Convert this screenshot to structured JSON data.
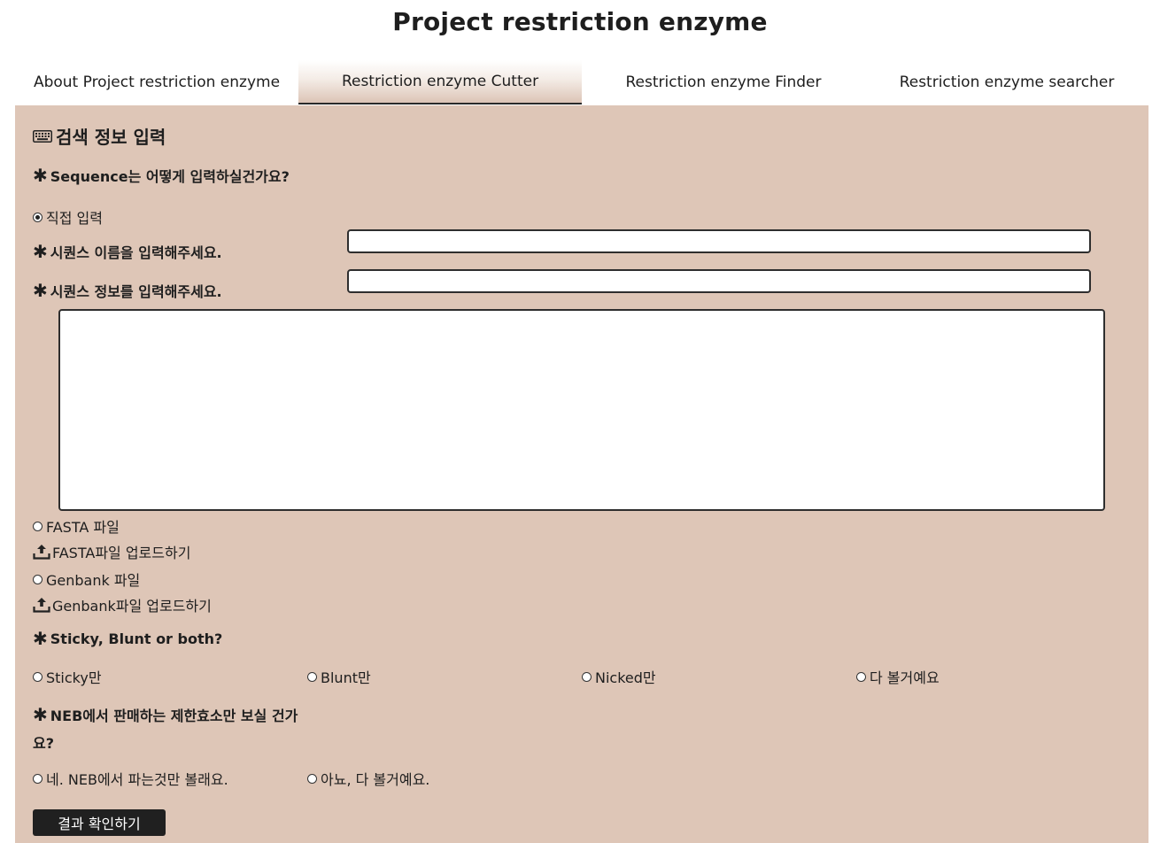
{
  "page": {
    "title": "Project restriction enzyme"
  },
  "tabs": [
    {
      "label": "About Project restriction enzyme",
      "active": false
    },
    {
      "label": "Restriction enzyme Cutter",
      "active": true
    },
    {
      "label": "Restriction enzyme Finder",
      "active": false
    },
    {
      "label": "Restriction enzyme searcher",
      "active": false
    }
  ],
  "form": {
    "section_title": "검색 정보 입력",
    "section_icon": "keyboard-icon",
    "q_input_method": "Sequence는 어떻게 입력하실건가요?",
    "opt_direct": "직접 입력",
    "seq_name_label": "시퀀스 이름을 입력해주세요.",
    "seq_name_value": "",
    "seq_info_label": "시퀀스 정보를 입력해주세요.",
    "seq_info_value": "",
    "seq_textarea_value": "",
    "opt_fasta": "FASTA 파일",
    "fasta_upload": "FASTA파일 업로드하기",
    "opt_genbank": "Genbank 파일",
    "genbank_upload": "Genbank파일 업로드하기",
    "upload_icon": "upload-icon",
    "q_end_type": "Sticky, Blunt or both?",
    "end_options": [
      "Sticky만",
      "Blunt만",
      "Nicked만",
      "다 볼거예요"
    ],
    "q_neb_line1": "NEB에서 판매하는 제한효소만 보실 건가",
    "q_neb_line2": "요?",
    "neb_options": [
      "네. NEB에서 파는것만 볼래요.",
      "아뇨, 다 볼거예요."
    ],
    "submit_label": "결과 확인하기",
    "colors": {
      "panel_bg": "#dec6b7",
      "button_bg": "#202020"
    }
  }
}
